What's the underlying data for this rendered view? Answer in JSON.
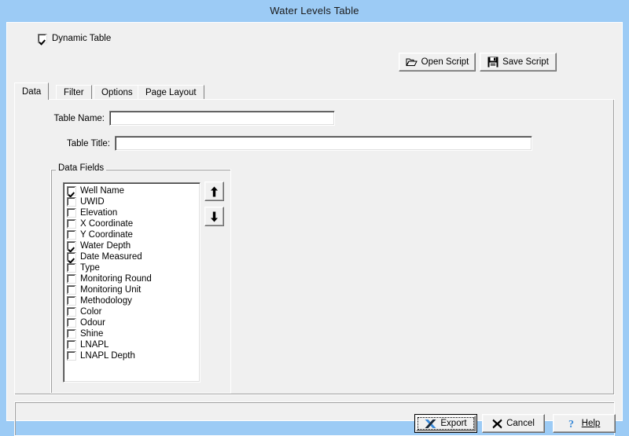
{
  "window": {
    "title": "Water Levels Table",
    "titlebar_color": "#9ccbf5",
    "face_color": "#f0f0f0"
  },
  "toolbar": {
    "dynamic_table_label": "Dynamic Table",
    "dynamic_table_checked": true,
    "open_script_label": "Open Script",
    "open_script_icon": "open-folder-icon",
    "save_script_label": "Save Script",
    "save_script_icon": "floppy-disk-icon"
  },
  "tabs": [
    {
      "label": "Data",
      "selected": true
    },
    {
      "label": "Filter",
      "selected": false
    },
    {
      "label": "Options",
      "selected": false
    },
    {
      "label": "Page Layout",
      "selected": false
    }
  ],
  "form": {
    "table_name_label": "Table Name:",
    "table_name_value": "",
    "table_name_placeholder": "",
    "table_title_label": "Table Title:",
    "table_title_value": "",
    "table_title_placeholder": ""
  },
  "data_fields": {
    "legend": "Data Fields",
    "move_up_icon": "arrow-up-icon",
    "move_down_icon": "arrow-down-icon",
    "items": [
      {
        "label": "Well Name",
        "checked": true
      },
      {
        "label": "UWID",
        "checked": false
      },
      {
        "label": "Elevation",
        "checked": false
      },
      {
        "label": "X Coordinate",
        "checked": false
      },
      {
        "label": "Y Coordinate",
        "checked": false
      },
      {
        "label": "Water Depth",
        "checked": true
      },
      {
        "label": "Date Measured",
        "checked": true
      },
      {
        "label": "Type",
        "checked": false
      },
      {
        "label": "Monitoring Round",
        "checked": false
      },
      {
        "label": "Monitoring Unit",
        "checked": false
      },
      {
        "label": "Methodology",
        "checked": false
      },
      {
        "label": "Color",
        "checked": false
      },
      {
        "label": "Odour",
        "checked": false
      },
      {
        "label": "Shine",
        "checked": false
      },
      {
        "label": "LNAPL",
        "checked": false
      },
      {
        "label": "LNAPL Depth",
        "checked": false
      }
    ]
  },
  "footer": {
    "export_label": "Export",
    "export_icon": "excel-x-icon",
    "export_is_default": true,
    "cancel_label": "Cancel",
    "cancel_icon": "x-mark-icon",
    "help_label": "Help",
    "help_icon": "question-mark-icon"
  }
}
